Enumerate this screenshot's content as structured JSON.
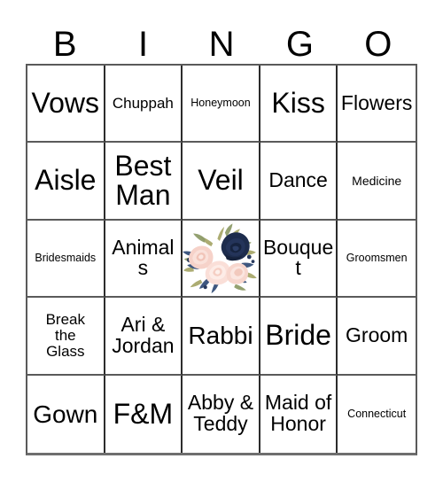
{
  "card": {
    "title": "BINGO",
    "header_letters": [
      "B",
      "I",
      "N",
      "G",
      "O"
    ],
    "columns": 5,
    "rows": 5,
    "colors": {
      "background": "#ffffff",
      "text": "#000000",
      "grid_line": "#2c2c2c",
      "grid_line_light": "#5a5a5a",
      "floral_navy": "#1d2c4d",
      "floral_navy_dark": "#141f38",
      "floral_blush": "#f5cfc6",
      "floral_blush_light": "#fae4dd",
      "floral_sage": "#9aa67a",
      "floral_olive": "#b3ae6e",
      "floral_leaf_blue": "#48618a"
    },
    "cells": [
      {
        "row": 1,
        "col": 1,
        "label": "Vows",
        "size": "fs-xl"
      },
      {
        "row": 1,
        "col": 2,
        "label": "Chuppah",
        "size": "fs-sm"
      },
      {
        "row": 1,
        "col": 3,
        "label": "Honeymoon",
        "size": "fs-xxs"
      },
      {
        "row": 1,
        "col": 4,
        "label": "Kiss",
        "size": "fs-xl"
      },
      {
        "row": 1,
        "col": 5,
        "label": "Flowers",
        "size": "fs-md"
      },
      {
        "row": 2,
        "col": 1,
        "label": "Aisle",
        "size": "fs-xl"
      },
      {
        "row": 2,
        "col": 2,
        "label": "Best\nMan",
        "size": "fs-xl"
      },
      {
        "row": 2,
        "col": 3,
        "label": "Veil",
        "size": "fs-xl"
      },
      {
        "row": 2,
        "col": 4,
        "label": "Dance",
        "size": "fs-md"
      },
      {
        "row": 2,
        "col": 5,
        "label": "Medicine",
        "size": "fs-xs"
      },
      {
        "row": 3,
        "col": 1,
        "label": "Bridesmaids",
        "size": "fs-xxs"
      },
      {
        "row": 3,
        "col": 2,
        "label": "Animals",
        "size": "fs-md"
      },
      {
        "row": 3,
        "col": 3,
        "label": "",
        "size": "free",
        "icon": "floral-bouquet-image"
      },
      {
        "row": 3,
        "col": 4,
        "label": "Bouquet",
        "size": "fs-md"
      },
      {
        "row": 3,
        "col": 5,
        "label": "Groomsmen",
        "size": "fs-xxs"
      },
      {
        "row": 4,
        "col": 1,
        "label": "Break\nthe\nGlass",
        "size": "fs-sm"
      },
      {
        "row": 4,
        "col": 2,
        "label": "Ari &\nJordan",
        "size": "fs-md"
      },
      {
        "row": 4,
        "col": 3,
        "label": "Rabbi",
        "size": "fs-lg"
      },
      {
        "row": 4,
        "col": 4,
        "label": "Bride",
        "size": "fs-xl"
      },
      {
        "row": 4,
        "col": 5,
        "label": "Groom",
        "size": "fs-md"
      },
      {
        "row": 5,
        "col": 1,
        "label": "Gown",
        "size": "fs-lg"
      },
      {
        "row": 5,
        "col": 2,
        "label": "F&M",
        "size": "fs-xl"
      },
      {
        "row": 5,
        "col": 3,
        "label": "Abby &\nTeddy",
        "size": "fs-md"
      },
      {
        "row": 5,
        "col": 4,
        "label": "Maid of\nHonor",
        "size": "fs-md"
      },
      {
        "row": 5,
        "col": 5,
        "label": "Connecticut",
        "size": "fs-xxs"
      }
    ]
  }
}
